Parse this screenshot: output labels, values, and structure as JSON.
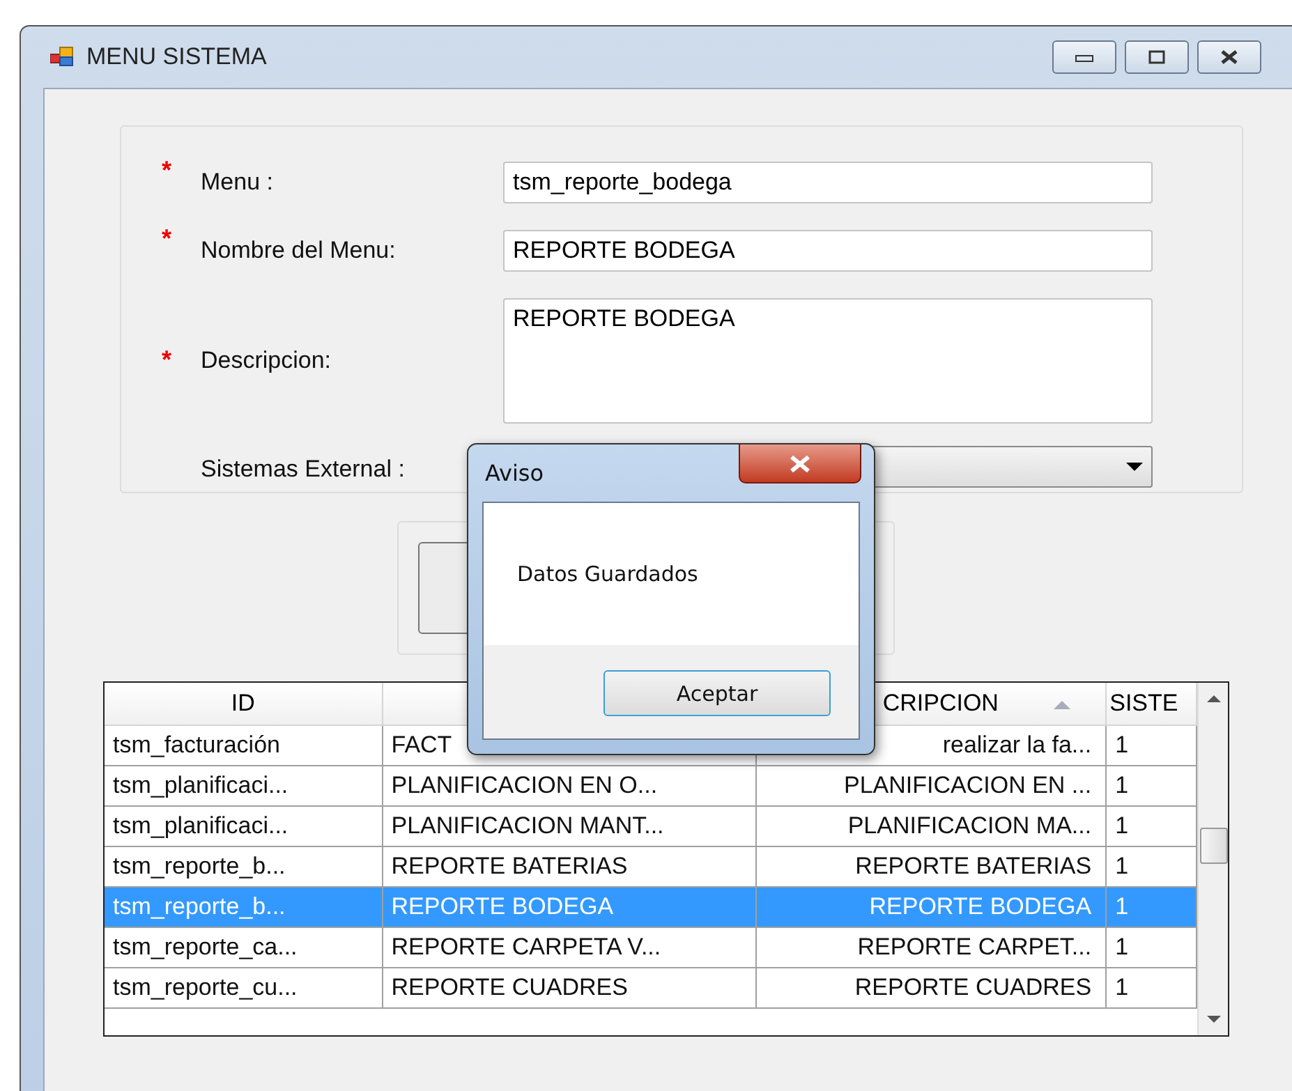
{
  "window": {
    "title": "MENU SISTEMA"
  },
  "form": {
    "fields": [
      {
        "label": "Menu :",
        "marker": "*",
        "kind": "text",
        "value": "tsm_reporte_bodega"
      },
      {
        "label": "Nombre del Menu:",
        "marker": "*",
        "kind": "text",
        "value": "REPORTE BODEGA"
      },
      {
        "label": "Descripcion:",
        "marker": "*",
        "kind": "multiline",
        "value": "REPORTE BODEGA"
      },
      {
        "label": "Sistemas External :",
        "kind": "dropdown"
      }
    ]
  },
  "table": {
    "columns": [
      {
        "label": "ID",
        "sorted": false
      },
      {},
      {
        "label": "CRIPCION",
        "sorted": true
      },
      {
        "label": "SISTE",
        "sorted": false
      }
    ],
    "rows": [
      {
        "selected": false,
        "cells": [
          "tsm_facturación",
          "FACT",
          "realizar la fa...",
          "1"
        ]
      },
      {
        "selected": false,
        "cells": [
          "tsm_planificaci...",
          "PLANIFICACION EN O...",
          "PLANIFICACION EN ...",
          "1"
        ]
      },
      {
        "selected": false,
        "cells": [
          "tsm_planificaci...",
          "PLANIFICACION MANT...",
          "PLANIFICACION MA...",
          "1"
        ]
      },
      {
        "selected": false,
        "cells": [
          "tsm_reporte_b...",
          "REPORTE BATERIAS",
          "REPORTE BATERIAS",
          "1"
        ]
      },
      {
        "selected": true,
        "cells": [
          "tsm_reporte_b...",
          "REPORTE BODEGA",
          "REPORTE BODEGA",
          "1"
        ]
      },
      {
        "selected": false,
        "cells": [
          "tsm_reporte_ca...",
          "REPORTE CARPETA V...",
          "REPORTE CARPET...",
          "1"
        ]
      },
      {
        "selected": false,
        "cells": [
          "tsm_reporte_cu...",
          "REPORTE CUADRES",
          "REPORTE CUADRES",
          "1"
        ]
      }
    ]
  },
  "dialog": {
    "title": "Aviso",
    "message": "Datos Guardados",
    "button": "Aceptar"
  }
}
